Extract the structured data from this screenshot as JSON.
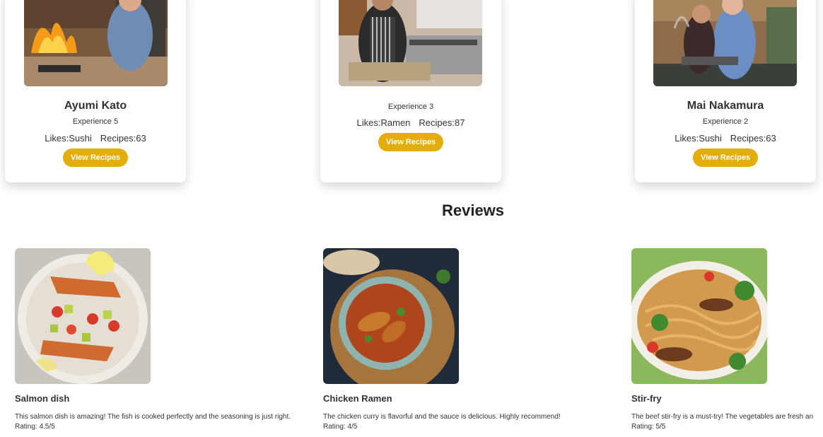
{
  "chefs": [
    {
      "name": "Ayumi Kato",
      "experience": "Experience 5",
      "likes": "Likes:Sushi",
      "recipes": "Recipes:63",
      "button": "View Recipes",
      "photo": "chef-flambe-photo"
    },
    {
      "name": "",
      "experience": "Experience 3",
      "likes": "Likes:Ramen",
      "recipes": "Recipes:87",
      "button": "View Recipes",
      "photo": "chef-apron-photo"
    },
    {
      "name": "Mai Nakamura",
      "experience": "Experience 2",
      "likes": "Likes:Sushi",
      "recipes": "Recipes:63",
      "button": "View Recipes",
      "photo": "chef-couple-photo"
    }
  ],
  "reviews_section": {
    "title": "Reviews",
    "items": [
      {
        "title": "Salmon dish",
        "text": "This salmon dish is amazing! The fish is cooked perfectly and the seasoning is just right.",
        "rating": "Rating: 4.5/5",
        "photo": "salmon-dish-photo"
      },
      {
        "title": "Chicken Ramen",
        "text": "The chicken curry is flavorful and the sauce is delicious. Highly recommend!",
        "rating": "Rating: 4/5",
        "photo": "chicken-curry-photo"
      },
      {
        "title": "Stir-fry",
        "text": "The beef stir-fry is a must-try! The vegetables are fresh an",
        "rating": "Rating: 5/5",
        "photo": "stir-fry-photo"
      }
    ]
  },
  "colors": {
    "button": "#e3ad0c",
    "text": "#333333",
    "background": "#ffffff"
  }
}
